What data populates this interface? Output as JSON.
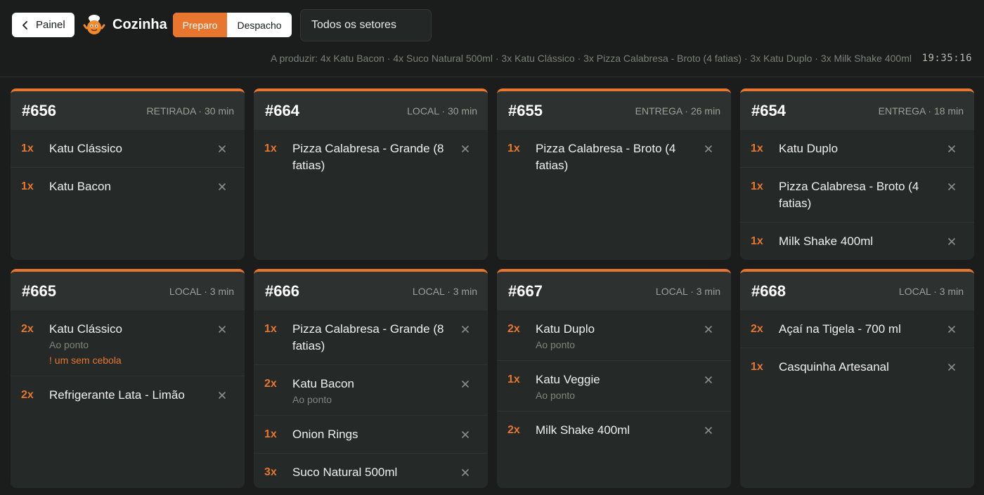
{
  "header": {
    "back_label": "Painel",
    "title": "Cozinha",
    "tabs": [
      "Preparo",
      "Despacho"
    ],
    "active_tab": "Preparo",
    "sector_select": "Todos os setores",
    "summary": "A produzir: 4x Katu Bacon · 4x Suco Natural 500ml · 3x Katu Clássico · 3x Pizza Calabresa - Broto (4 fatias) · 3x Katu Duplo · 3x Milk Shake 400ml",
    "clock": "19:35:16"
  },
  "colors": {
    "accent": "#e8762e",
    "background": "#1a1d1b",
    "card": "#252927"
  },
  "orders": [
    {
      "number": "#656",
      "meta": "RETIRADA · 30 min",
      "items": [
        {
          "qty": "1x",
          "name": "Katu Clássico"
        },
        {
          "qty": "1x",
          "name": "Katu Bacon"
        }
      ]
    },
    {
      "number": "#664",
      "meta": "LOCAL · 30 min",
      "items": [
        {
          "qty": "1x",
          "name": "Pizza Calabresa - Grande (8 fatias)"
        }
      ]
    },
    {
      "number": "#655",
      "meta": "ENTREGA · 26 min",
      "items": [
        {
          "qty": "1x",
          "name": "Pizza Calabresa - Broto (4 fatias)"
        }
      ]
    },
    {
      "number": "#654",
      "meta": "ENTREGA · 18 min",
      "items": [
        {
          "qty": "1x",
          "name": "Katu Duplo"
        },
        {
          "qty": "1x",
          "name": "Pizza Calabresa - Broto (4 fatias)"
        },
        {
          "qty": "1x",
          "name": "Milk Shake 400ml"
        }
      ]
    },
    {
      "number": "#665",
      "meta": "LOCAL · 3 min",
      "items": [
        {
          "qty": "2x",
          "name": "Katu Clássico",
          "note": "Ao ponto",
          "warn": "! um sem cebola"
        },
        {
          "qty": "2x",
          "name": "Refrigerante Lata - Limão"
        }
      ]
    },
    {
      "number": "#666",
      "meta": "LOCAL · 3 min",
      "items": [
        {
          "qty": "1x",
          "name": "Pizza Calabresa - Grande (8 fatias)"
        },
        {
          "qty": "2x",
          "name": "Katu Bacon",
          "note": "Ao ponto"
        },
        {
          "qty": "1x",
          "name": "Onion Rings"
        },
        {
          "qty": "3x",
          "name": "Suco Natural 500ml"
        }
      ]
    },
    {
      "number": "#667",
      "meta": "LOCAL · 3 min",
      "items": [
        {
          "qty": "2x",
          "name": "Katu Duplo",
          "note": "Ao ponto"
        },
        {
          "qty": "1x",
          "name": "Katu Veggie",
          "note": "Ao ponto"
        },
        {
          "qty": "2x",
          "name": "Milk Shake 400ml"
        }
      ]
    },
    {
      "number": "#668",
      "meta": "LOCAL · 3 min",
      "items": [
        {
          "qty": "2x",
          "name": "Açaí na Tigela - 700 ml"
        },
        {
          "qty": "1x",
          "name": "Casquinha Artesanal"
        }
      ]
    }
  ]
}
